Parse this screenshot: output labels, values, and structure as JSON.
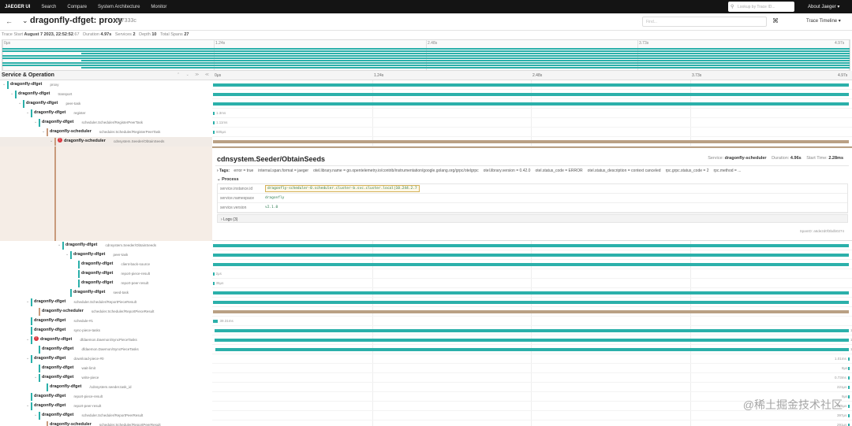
{
  "nav": {
    "brand": "JAEGER UI",
    "items": [
      "Search",
      "Compare",
      "System Architecture",
      "Monitor"
    ],
    "lookup_placeholder": "Lookup by Trace ID...",
    "about": "About Jaeger ▾"
  },
  "trace": {
    "title": "dragonfly-dfget: proxy",
    "trace_id": "d27333c",
    "find_placeholder": "Find...",
    "view_mode": "Trace Timeline ▾",
    "stats": {
      "start_label": "Trace Start",
      "start": "August 7 2023, 22:52:52",
      "start_ms": ".67",
      "duration_label": "Duration",
      "duration": "4.97s",
      "services_label": "Services",
      "services": "2",
      "depth_label": "Depth",
      "depth": "10",
      "spans_label": "Total Spans",
      "spans": "27"
    }
  },
  "minimap_ticks": [
    "0μs",
    "1.24s",
    "2.48s",
    "3.73s",
    "4.97s"
  ],
  "header": {
    "title": "Service & Operation",
    "ticks": [
      "0μs",
      "1.24s",
      "2.48s",
      "3.73s",
      "4.97s"
    ]
  },
  "rows": [
    {
      "svc": "dragonfly-dfget",
      "op": "proxy",
      "depth": 0,
      "toggle": "⌄",
      "start": 0,
      "dur": 1.0,
      "label": ""
    },
    {
      "svc": "dragonfly-dfget",
      "op": "transport",
      "depth": 1,
      "toggle": "⌄",
      "start": 0,
      "dur": 1.0,
      "label": ""
    },
    {
      "svc": "dragonfly-dfget",
      "op": "peer-task",
      "depth": 2,
      "toggle": "⌄",
      "start": 0,
      "dur": 1.0,
      "label": ""
    },
    {
      "svc": "dragonfly-dfget",
      "op": "register",
      "depth": 3,
      "toggle": "⌄",
      "start": 0,
      "dur": 0.0015,
      "label": "1.3ms"
    },
    {
      "svc": "dragonfly-dfget",
      "op": "scheduler.Scheduler/RegisterPeerTask",
      "depth": 4,
      "toggle": "⌄",
      "start": 0,
      "dur": 0.0012,
      "label": "1.11ms"
    },
    {
      "svc": "dragonfly-scheduler",
      "op": "scheduler.Scheduler/RegisterPeerTask",
      "depth": 5,
      "toggle": "⌄",
      "start": 0,
      "dur": 0.0008,
      "label": "605μs"
    },
    {
      "svc": "dragonfly-scheduler",
      "op": "cdnsystem.Seeder/ObtainSeeds",
      "depth": 6,
      "toggle": "⌄",
      "start": 0,
      "dur": 1.0,
      "label": "",
      "error": true,
      "selected": true
    }
  ],
  "detail": {
    "operation": "cdnsystem.Seeder/ObtainSeeds",
    "service_label": "Service:",
    "service": "dragonfly-scheduler",
    "duration_label": "Duration:",
    "duration": "4.96s",
    "start_label": "Start Time:",
    "start": "2.28ms",
    "tags_label": "Tags:",
    "tags": [
      "error = true",
      "internal.span.format = jaeger",
      "otel.library.name = go.opentelemetry.io/contrib/instrumentation/google.golang.org/grpc/otelgrpc",
      "otel.library.version = 0.42.0",
      "otel.status_code = ERROR",
      "otel.status_description = context canceled",
      "rpc.grpc.status_code = 2",
      "rpc.method = ..."
    ],
    "process_label": "Process",
    "process": [
      {
        "k": "service.instance.id",
        "v": "dragonfly-scheduler-0.scheduler.cluster-b.svc.cluster.local|10.244.2.7",
        "hl": true
      },
      {
        "k": "service.namespace",
        "v": "dragonfly"
      },
      {
        "k": "service.version",
        "v": "v2.1.0"
      }
    ],
    "logs_label": "Logs (3)",
    "span_id": "SpanID: a6de2d0f3bdb0274"
  },
  "rows2": [
    {
      "svc": "dragonfly-dfget",
      "op": "cdnsystem.Seeder/ObtainSeeds",
      "depth": 7,
      "toggle": "⌄",
      "start": 0,
      "dur": 1.0,
      "label": ""
    },
    {
      "svc": "dragonfly-dfget",
      "op": "peer-task",
      "depth": 8,
      "toggle": "⌄",
      "start": 0,
      "dur": 1.0,
      "label": ""
    },
    {
      "svc": "dragonfly-dfget",
      "op": "client-back-source",
      "depth": 9,
      "toggle": "",
      "start": 0,
      "dur": 1.0,
      "label": ""
    },
    {
      "svc": "dragonfly-dfget",
      "op": "report-piece-result",
      "depth": 9,
      "toggle": "",
      "start": 0,
      "dur": 0.0,
      "label": "2μs"
    },
    {
      "svc": "dragonfly-dfget",
      "op": "report-peer-result",
      "depth": 9,
      "toggle": "",
      "start": 0,
      "dur": 0.0,
      "label": "35μs"
    },
    {
      "svc": "dragonfly-dfget",
      "op": "seed-task",
      "depth": 8,
      "toggle": "",
      "start": 0,
      "dur": 1.0,
      "label": ""
    },
    {
      "svc": "dragonfly-dfget",
      "op": "scheduler.Scheduler/ReportPieceResult",
      "depth": 3,
      "toggle": "⌄",
      "start": 0,
      "dur": 1.0,
      "label": ""
    },
    {
      "svc": "dragonfly-scheduler",
      "op": "scheduler.Scheduler/ReportPieceResult",
      "depth": 4,
      "toggle": "",
      "start": 0,
      "dur": 1.0,
      "label": "",
      "brown": true
    },
    {
      "svc": "dragonfly-dfget",
      "op": "schedule-#1",
      "depth": 3,
      "toggle": "",
      "start": 0,
      "dur": 0.008,
      "label": "39.31ms"
    },
    {
      "svc": "dragonfly-dfget",
      "op": "sync-piece-tasks",
      "depth": 3,
      "toggle": "",
      "start": 0.002,
      "dur": 0.998,
      "label": "1s"
    },
    {
      "svc": "dragonfly-dfget",
      "op": "dfdaemon.Daemon/SyncPieceTasks",
      "depth": 3,
      "toggle": "⌄",
      "start": 0.003,
      "dur": 0.997,
      "label": "1s",
      "error": true
    },
    {
      "svc": "dragonfly-dfget",
      "op": "dfdaemon.Daemon/SyncPieceTasks",
      "depth": 4,
      "toggle": "",
      "start": 0.004,
      "dur": 0.996,
      "label": "1s"
    },
    {
      "svc": "dragonfly-dfget",
      "op": "download-piece-#0",
      "depth": 3,
      "toggle": "⌄",
      "start": 0.999,
      "dur": 0.0,
      "label": "1.01ms"
    },
    {
      "svc": "dragonfly-dfget",
      "op": "wait-limit",
      "depth": 4,
      "toggle": "",
      "start": 0.999,
      "dur": 0.0,
      "label": "8μs"
    },
    {
      "svc": "dragonfly-dfget",
      "op": "write-piece",
      "depth": 4,
      "toggle": "⌄",
      "start": 0.999,
      "dur": 0.0,
      "label": "0.73ms"
    },
    {
      "svc": "dragonfly-dfget",
      "op": "/cdnsystem.seeder.task_id",
      "depth": 5,
      "toggle": "",
      "start": 0.999,
      "dur": 0.0,
      "label": "221μs"
    },
    {
      "svc": "dragonfly-dfget",
      "op": "report-piece-result",
      "depth": 3,
      "toggle": "",
      "start": 0.999,
      "dur": 0.0,
      "label": "9μs"
    },
    {
      "svc": "dragonfly-dfget",
      "op": "report-peer-result",
      "depth": 3,
      "toggle": "⌄",
      "start": 0.999,
      "dur": 0.0,
      "label": "975μs"
    },
    {
      "svc": "dragonfly-dfget",
      "op": "scheduler.Scheduler/ReportPeerResult",
      "depth": 4,
      "toggle": "⌄",
      "start": 0.999,
      "dur": 0.0,
      "label": "397μs"
    },
    {
      "svc": "dragonfly-scheduler",
      "op": "scheduler.Scheduler/ReportPeerResult",
      "depth": 5,
      "toggle": "",
      "start": 0.999,
      "dur": 0.0,
      "label": "291μs"
    }
  ],
  "watermark": "@稀土掘金技术社区"
}
